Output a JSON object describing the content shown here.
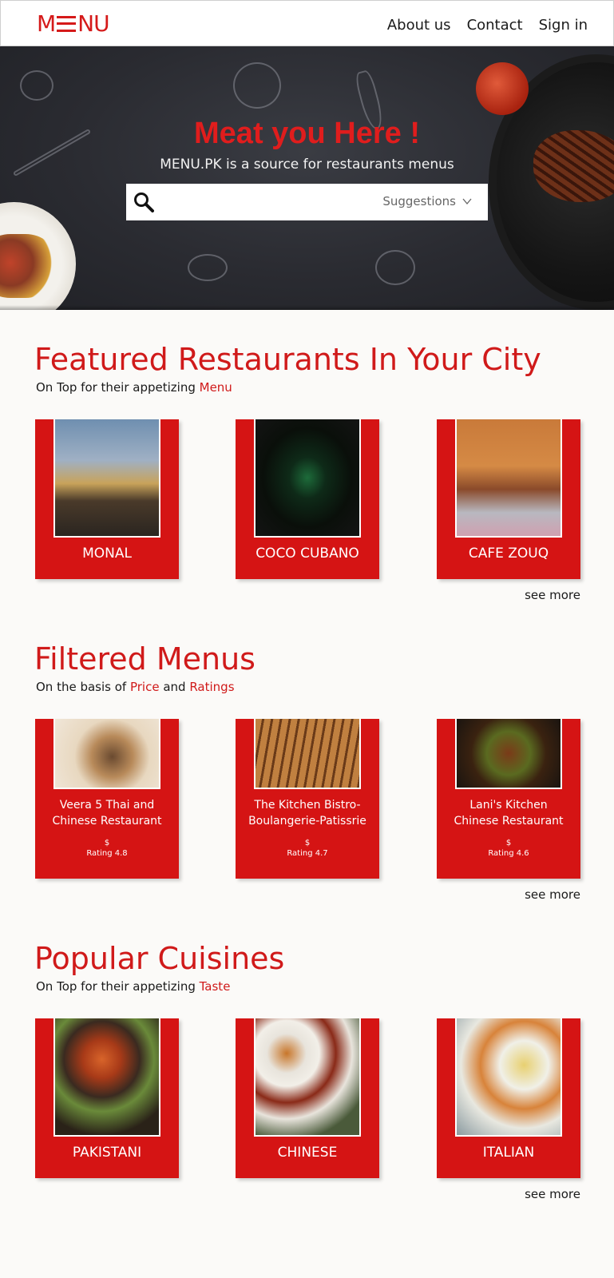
{
  "header": {
    "logo": {
      "pre": "M",
      "post": "NU"
    },
    "nav": [
      {
        "label": "About us"
      },
      {
        "label": "Contact"
      },
      {
        "label": "Sign in"
      }
    ]
  },
  "hero": {
    "title": "Meat you Here !",
    "subtitle": "MENU.PK is a source for restaurants menus",
    "search_placeholder": "",
    "suggestions_label": "Suggestions"
  },
  "featured": {
    "title": "Featured Restaurants In Your City",
    "subtitle_pre": "On Top for their appetizing ",
    "subtitle_hl": "Menu",
    "cards": [
      {
        "label": "MONAL"
      },
      {
        "label": "COCO CUBANO"
      },
      {
        "label": "CAFE ZOUQ"
      }
    ],
    "see_more": "see more"
  },
  "filtered": {
    "title": "Filtered Menus",
    "subtitle_pre": "On the basis of ",
    "subtitle_hl1": "Price",
    "subtitle_mid": " and ",
    "subtitle_hl2": "Ratings",
    "cards": [
      {
        "name_line1": "Veera 5 Thai and",
        "name_line2": "Chinese Restaurant",
        "price": "$",
        "rating": "Rating 4.8"
      },
      {
        "name_line1": "The Kitchen Bistro-",
        "name_line2": "Boulangerie-Patissrie",
        "price": "$",
        "rating": "Rating 4.7"
      },
      {
        "name_line1": "Lani's Kitchen",
        "name_line2": "Chinese Restaurant",
        "price": "$",
        "rating": "Rating 4.6"
      }
    ],
    "see_more": "see more"
  },
  "cuisines": {
    "title": "Popular Cuisines",
    "subtitle_pre": "On Top for their appetizing ",
    "subtitle_hl": "Taste",
    "cards": [
      {
        "label": "PAKISTANI"
      },
      {
        "label": "CHINESE"
      },
      {
        "label": "ITALIAN"
      }
    ],
    "see_more": "see more"
  },
  "colors": {
    "brand_red": "#d51414",
    "title_red": "#d01a1a",
    "hero_bg": "#2a2b31"
  }
}
